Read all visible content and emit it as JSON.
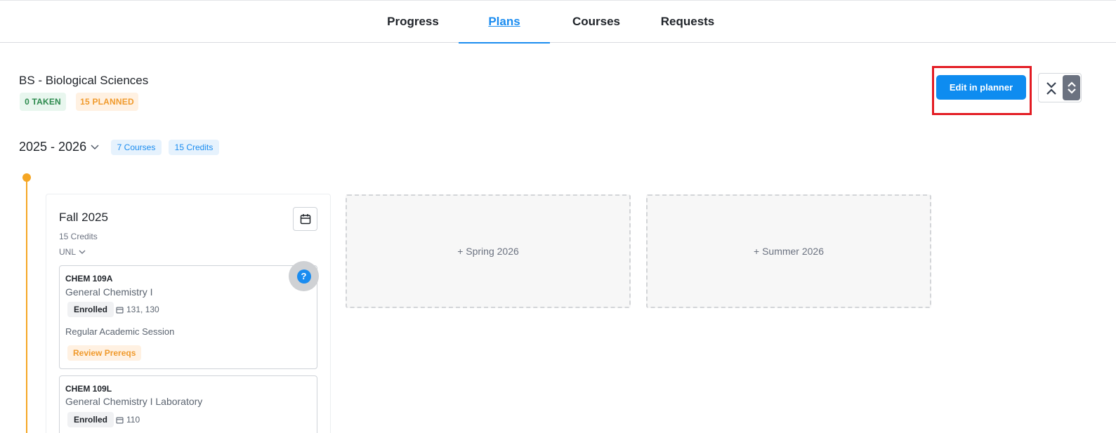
{
  "nav": {
    "tabs": [
      {
        "label": "Progress"
      },
      {
        "label": "Plans",
        "active": true
      },
      {
        "label": "Courses"
      },
      {
        "label": "Requests"
      }
    ]
  },
  "program": {
    "title": "BS - Biological Sciences",
    "taken_badge": "0 TAKEN",
    "planned_badge": "15 PLANNED"
  },
  "actions": {
    "edit_label": "Edit in planner",
    "collapse_icon": "collapse-icon",
    "expand_icon": "expand-icon"
  },
  "year": {
    "title": "2025 - 2026",
    "courses_badge": "7 Courses",
    "credits_badge": "15 Credits"
  },
  "terms": [
    {
      "title": "Fall 2025",
      "credits": "15 Credits",
      "school": "UNL",
      "courses": [
        {
          "code": "CHEM 109A",
          "name": "General Chemistry I",
          "status": "Enrolled",
          "sections": "131, 130",
          "session": "Regular Academic Session",
          "prereq_label": "Review Prereqs"
        },
        {
          "code": "CHEM 109L",
          "name": "General Chemistry I Laboratory",
          "status": "Enrolled",
          "sections": "110"
        }
      ]
    }
  ],
  "add_terms": [
    {
      "label": "+ Spring 2026"
    },
    {
      "label": "+ Summer 2026"
    }
  ],
  "help": {
    "symbol": "?"
  },
  "colors": {
    "accent": "#1a8cf0",
    "timeline": "#f5a623",
    "taken": "#2c8a4d",
    "planned": "#f09a2c",
    "highlight": "#e31b23"
  }
}
